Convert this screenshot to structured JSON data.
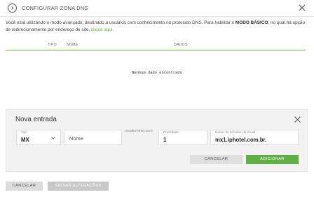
{
  "header": {
    "title": "CONFIGURAR ZONA DNS",
    "back_icon": "chevron-right-circle-icon",
    "close_icon": "close-icon"
  },
  "description": {
    "text_before": "Você está utilizando o modo avançado, destinado a usuários com conhecimento no protocolo DNS. Para habilitar o ",
    "bold": "MODO BÁSICO",
    "text_after": ", no qual há opção de redirecionamento por endereço de site, ",
    "link": "clique aqui",
    "end": "."
  },
  "table": {
    "columns": [
      "TIPO",
      "NOME",
      "DADOS"
    ],
    "empty_message": "Nenhum dado encontrado"
  },
  "new_entry": {
    "title": "Nova entrada",
    "type_label": "Tipo",
    "type_value": "MX",
    "name_placeholder": "Nome",
    "domain_suffix": ".seudominio.com",
    "priority_label": "Prioridade",
    "priority_value": "1",
    "server_label": "Nome do servidor de email",
    "server_value": "mx1.iphotel.com.br.",
    "cancel_label": "CANCELAR",
    "add_label": "ADICIONAR"
  },
  "footer": {
    "cancel_label": "CANCELAR",
    "save_label": "SALVAR ALTERAÇÕES"
  },
  "colors": {
    "accent_green": "#5fb146",
    "link_green": "#6cb33e",
    "panel_bg": "#f2f2f2"
  }
}
